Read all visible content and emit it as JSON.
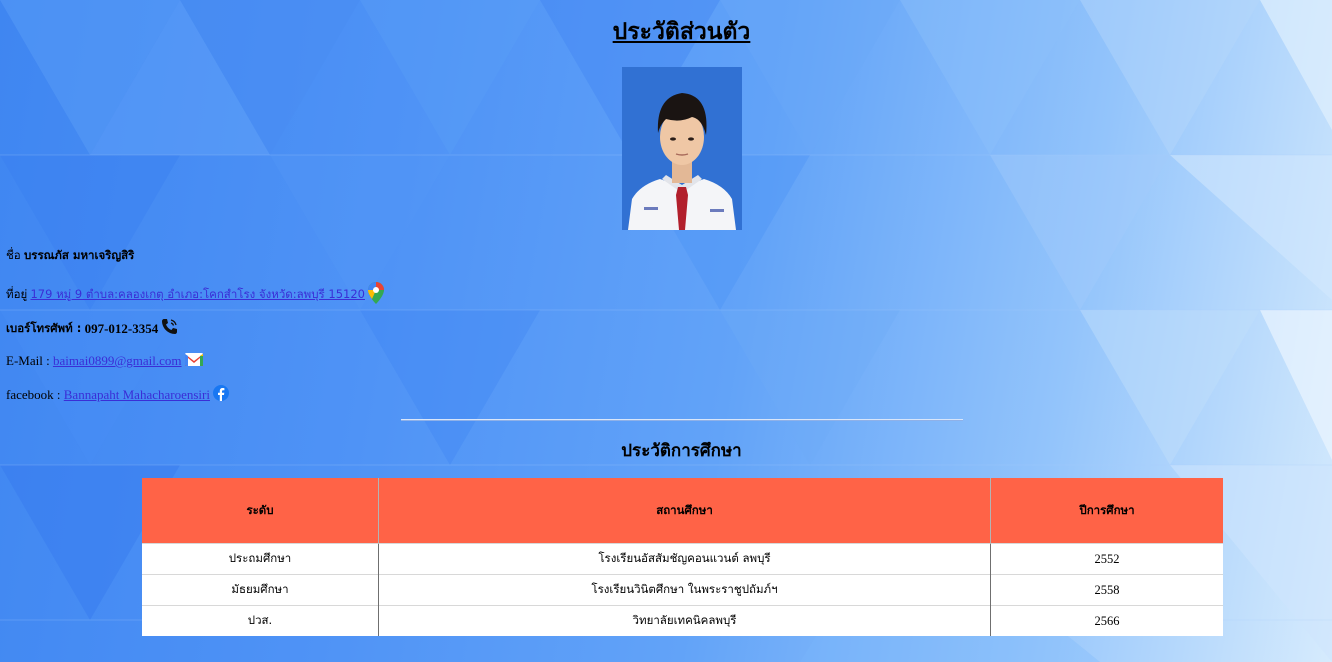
{
  "page_title": "ประวัติส่วนตัว",
  "photo": {
    "alt": "student-portrait"
  },
  "name_line": {
    "label": "ชื่อ",
    "value": "บรรณภัส มหาเจริญสิริ"
  },
  "address_line": {
    "label": "ที่อยู่",
    "link_text": "179 หมู่ 9 ตำบล:คลองเกตุ อำเภอ:โคกสำโรง จังหวัด:ลพบุรี 15120",
    "icon": "google-maps-icon"
  },
  "phone_line": {
    "label": "เบอร์โทรศัพท์ :",
    "value": "097-012-3354",
    "icon": "phone-icon"
  },
  "email_line": {
    "label": "E-Mail :",
    "link_text": "baimai0899@gmail.com",
    "icon": "gmail-icon"
  },
  "facebook_line": {
    "label": "facebook :",
    "link_text": "Bannapaht Mahacharoensiri",
    "icon": "facebook-icon"
  },
  "education": {
    "title": "ประวัติการศึกษา",
    "headers": [
      "ระดับ",
      "สถานศึกษา",
      "ปีการศึกษา"
    ],
    "rows": [
      [
        "ประถมศึกษา",
        "โรงเรียนอัสสัมชัญคอนแวนต์ ลพบุรี",
        "2552"
      ],
      [
        "มัธยมศึกษา",
        "โรงเรียนวินิตศึกษา ในพระราชูปถัมภ์ฯ",
        "2558"
      ],
      [
        "ปวส.",
        "วิทยาลัยเทคนิคลพบุรี",
        "2566"
      ]
    ]
  },
  "colors": {
    "table_header": "#ff6347",
    "link": "#3a2ed6",
    "background_start": "#3f86f1",
    "background_end": "#d6ebfd"
  }
}
